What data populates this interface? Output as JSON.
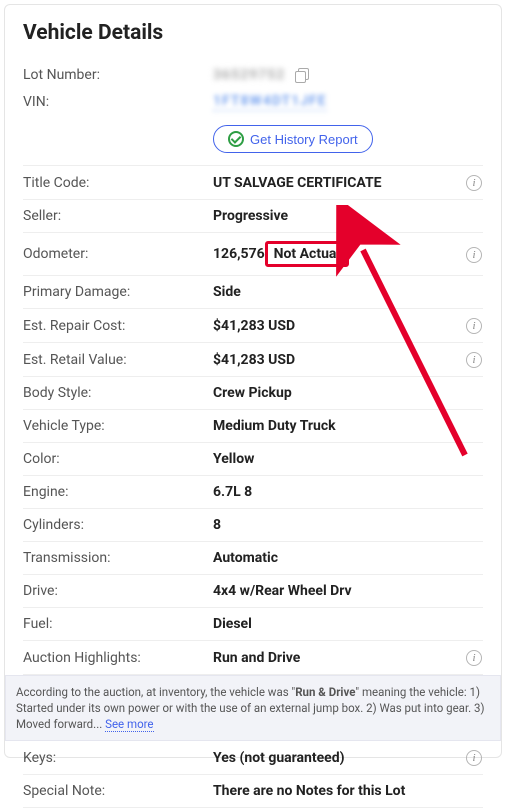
{
  "title": "Vehicle Details",
  "lotNumber": {
    "label": "Lot Number:",
    "value": "36529752"
  },
  "vin": {
    "label": "VIN:",
    "value": "1FT8W4DT1JFE"
  },
  "historyButton": "Get History Report",
  "rows": {
    "titleCode": {
      "label": "Title Code:",
      "value": "UT SALVAGE CERTIFICATE",
      "info": true
    },
    "seller": {
      "label": "Seller:",
      "value": "Progressive"
    },
    "odometer": {
      "label": "Odometer:",
      "value": "126,576",
      "suffix": "Not Actual",
      "info": true
    },
    "primaryDamage": {
      "label": "Primary Damage:",
      "value": "Side"
    },
    "repairCost": {
      "label": "Est. Repair Cost:",
      "value": "$41,283 USD",
      "info": true
    },
    "retailValue": {
      "label": "Est. Retail Value:",
      "value": "$41,283 USD",
      "info": true
    },
    "bodyStyle": {
      "label": "Body Style:",
      "value": "Crew Pickup"
    },
    "vehicleType": {
      "label": "Vehicle Type:",
      "value": "Medium Duty Truck"
    },
    "color": {
      "label": "Color:",
      "value": "Yellow"
    },
    "engine": {
      "label": "Engine:",
      "value": "6.7L 8"
    },
    "cylinders": {
      "label": "Cylinders:",
      "value": "8"
    },
    "transmission": {
      "label": "Transmission:",
      "value": "Automatic"
    },
    "drive": {
      "label": "Drive:",
      "value": "4x4 w/Rear Wheel Drv"
    },
    "fuel": {
      "label": "Fuel:",
      "value": "Diesel"
    },
    "highlights": {
      "label": "Auction Highlights:",
      "value": "Run and Drive",
      "info": true
    },
    "keys": {
      "label": "Keys:",
      "value": "Yes (not guaranteed)",
      "info": true
    },
    "specialNote": {
      "label": "Special Note:",
      "value": "There are no Notes for this Lot"
    }
  },
  "note": {
    "prefix": "According to the auction, at inventory, the vehicle was \"",
    "bold": "Run & Drive",
    "suffix": "\" meaning the vehicle: 1) Started under its own power or with the use of an external jump box. 2) Was put into gear. 3) Moved forward... ",
    "seeMore": "See more"
  }
}
